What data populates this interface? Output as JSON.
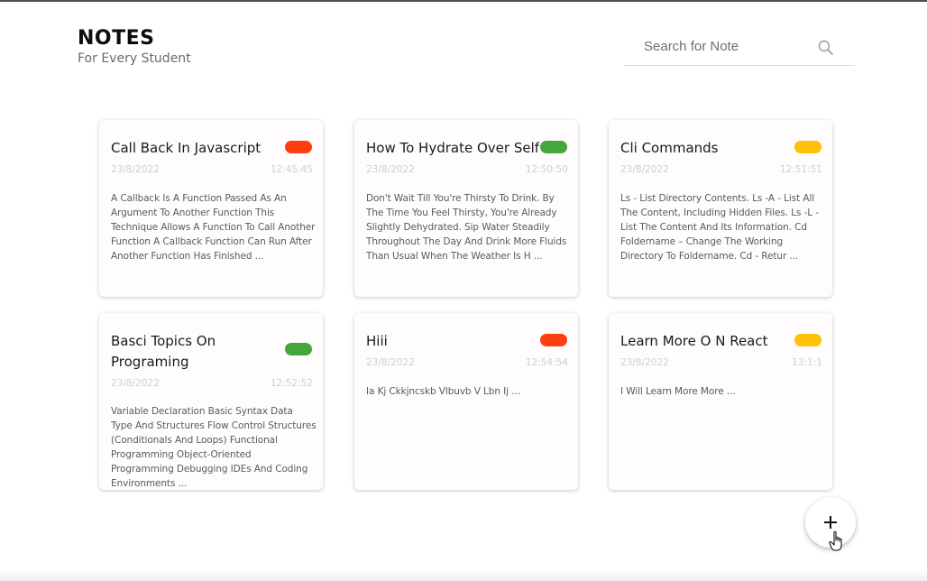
{
  "header": {
    "title": "NOTES",
    "subtitle": "For Every Student"
  },
  "search": {
    "placeholder": "Search for Note",
    "icon": "search-icon"
  },
  "colors": {
    "red": "#ff3d0f",
    "green": "#45a73b",
    "yellow": "#ffc107"
  },
  "notes": [
    {
      "title": "Call Back In Javascript",
      "date": "23/8/2022",
      "time": "12:45:45",
      "tag_color": "#ff3d0f",
      "body": "A Callback Is A Function Passed As An Argument To Another Function This Technique Allows A Function To Call Another Function A Callback Function Can Run After Another Function Has Finished ..."
    },
    {
      "title": "How To Hydrate Over Self",
      "date": "23/8/2022",
      "time": "12:50:50",
      "tag_color": "#45a73b",
      "body": "Don't Wait Till You're Thirsty To Drink. By The Time You Feel Thirsty, You're Already Slightly Dehydrated. Sip Water Steadily Throughout The Day And Drink More Fluids Than Usual When The Weather Is H ..."
    },
    {
      "title": "Cli Commands",
      "date": "23/8/2022",
      "time": "12:51:51",
      "tag_color": "#ffc107",
      "body": "Ls - List Directory Contents. Ls -A - List All The Content, Including Hidden Files. Ls -L - List The Content And Its Information. Cd Foldername – Change The Working Directory To Foldername. Cd - Retur ..."
    },
    {
      "title": "Basci Topics On Programing",
      "date": "23/8/2022",
      "time": "12:52:52",
      "tag_color": "#45a73b",
      "body": "Variable Declaration Basic Syntax Data Type And Structures Flow Control Structures (Conditionals And Loops) Functional Programming Object-Oriented Programming Debugging IDEs And Coding Environments ..."
    },
    {
      "title": "Hiii",
      "date": "23/8/2022",
      "time": "12:54:54",
      "tag_color": "#ff3d0f",
      "body": "Ia Kj Ckkjncskb Vlbuvb V Lbn Ij ..."
    },
    {
      "title": "Learn More O N React",
      "date": "23/8/2022",
      "time": "13:1:1",
      "tag_color": "#ffc107",
      "body": "I Will Learn More More ..."
    }
  ],
  "fab": {
    "icon": "plus-icon"
  }
}
